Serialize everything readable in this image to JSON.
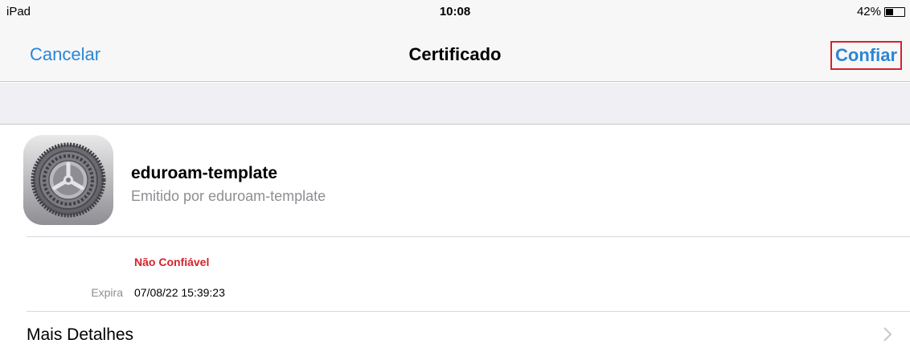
{
  "status_bar": {
    "device": "iPad",
    "time": "10:08",
    "battery_text": "42%",
    "battery_level": 0.42
  },
  "nav": {
    "cancel_label": "Cancelar",
    "title": "Certificado",
    "trust_label": "Confiar"
  },
  "profile": {
    "icon": "settings-gear-icon",
    "name": "eduroam-template",
    "issuer": "Emitido por eduroam-template",
    "status": "Não Confiável",
    "expires_label": "Expira",
    "expires_value": "07/08/22 15:39:23"
  },
  "more_details": {
    "label": "Mais Detalhes",
    "icon": "chevron-right-icon"
  },
  "colors": {
    "accent": "#2a86d6",
    "warning": "#d6222a",
    "highlight_box": "#d6222a",
    "secondary_text": "#8e8e93",
    "group_background": "#efeff4"
  }
}
